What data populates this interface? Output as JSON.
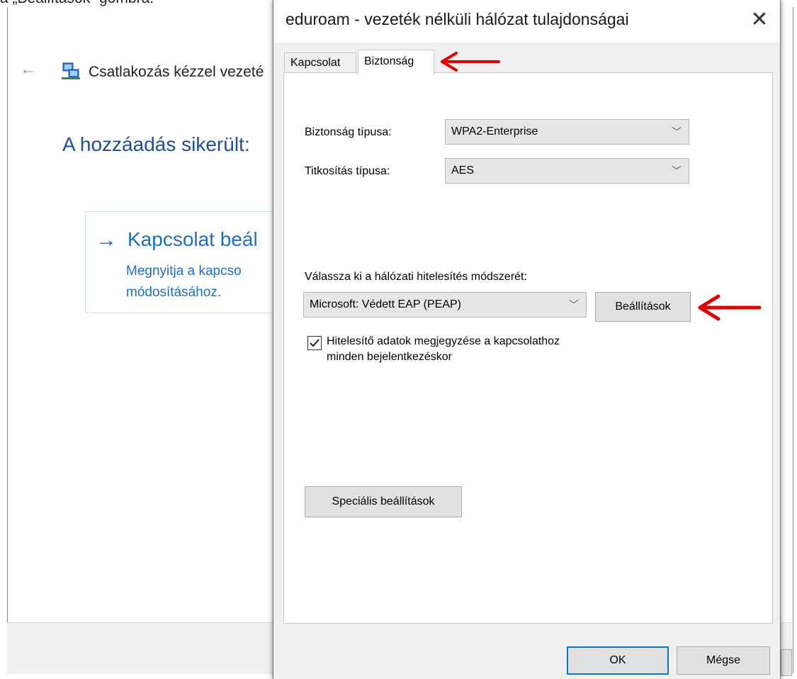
{
  "document": {
    "caption": "a „Beállítások” gombra."
  },
  "background_window": {
    "back_icon": "back-arrow-icon",
    "title": "Csatlakozás kézzel vezeté",
    "heading": "A hozzáadás sikerült:",
    "option": {
      "arrow": "→",
      "title": "Kapcsolat beál",
      "line1": "Megnyitja a kapcso",
      "line2": "módosításához."
    }
  },
  "dialog": {
    "title": "eduroam - vezeték nélküli hálózat tulajdonságai",
    "close_glyph": "✕",
    "tabs": [
      {
        "label": "Kapcsolat",
        "active": false
      },
      {
        "label": "Biztonság",
        "active": true
      }
    ],
    "security_type": {
      "label": "Biztonság típusa:",
      "value": "WPA2-Enterprise"
    },
    "encryption_type": {
      "label": "Titkosítás típusa:",
      "value": "AES"
    },
    "auth_method": {
      "label": "Válassza ki a hálózati hitelesítés módszerét:",
      "value": "Microsoft: Védett EAP (PEAP)",
      "settings_button": "Beállítások"
    },
    "remember_credentials": {
      "checked": true,
      "label_line1": "Hitelesítő adatok megjegyzése a kapcsolathoz",
      "label_line2": "minden bejelentkezéskor"
    },
    "advanced_button": "Speciális beállítások",
    "ok_button": "OK",
    "cancel_button": "Mégse",
    "chevron_glyph": "﹀"
  },
  "annotations": {
    "arrow_color": "#e00000"
  }
}
